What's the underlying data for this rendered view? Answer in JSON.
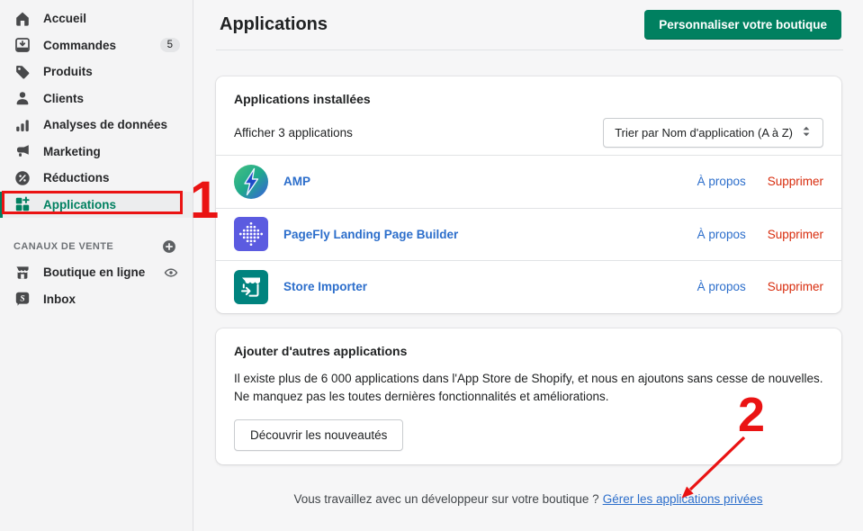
{
  "sidebar": {
    "items": [
      {
        "label": "Accueil"
      },
      {
        "label": "Commandes",
        "badge": "5"
      },
      {
        "label": "Produits"
      },
      {
        "label": "Clients"
      },
      {
        "label": "Analyses de données"
      },
      {
        "label": "Marketing"
      },
      {
        "label": "Réductions"
      },
      {
        "label": "Applications"
      }
    ],
    "section": {
      "title": "CANAUX DE VENTE"
    },
    "channels": [
      {
        "label": "Boutique en ligne"
      },
      {
        "label": "Inbox"
      }
    ]
  },
  "header": {
    "title": "Applications",
    "customize_button": "Personnaliser votre boutique"
  },
  "installed": {
    "title": "Applications installées",
    "count_label": "Afficher 3 applications",
    "sort_label": "Trier par Nom d'application (A à Z)",
    "apps": [
      {
        "name": "AMP",
        "about_label": "À propos",
        "remove_label": "Supprimer"
      },
      {
        "name": "PageFly Landing Page Builder",
        "about_label": "À propos",
        "remove_label": "Supprimer"
      },
      {
        "name": "Store Importer",
        "about_label": "À propos",
        "remove_label": "Supprimer"
      }
    ]
  },
  "discover": {
    "title": "Ajouter d'autres applications",
    "body": "Il existe plus de 6 000 applications dans l'App Store de Shopify, et nous en ajoutons sans cesse de nouvelles. Ne manquez pas les toutes dernières fonctionnalités et améliorations.",
    "button": "Découvrir les nouveautés"
  },
  "footer": {
    "question": "Vous travaillez avec un développeur sur votre boutique ?",
    "link": "Gérer les applications privées"
  },
  "annotations": {
    "step1": "1",
    "step2": "2"
  },
  "colors": {
    "accent_green": "#008060",
    "link_blue": "#2c6ecb",
    "critical_red": "#d82c0d",
    "annotation_red": "#ea1313",
    "pagefly_purple": "#5b5be0",
    "store_importer_teal": "#00837e"
  }
}
